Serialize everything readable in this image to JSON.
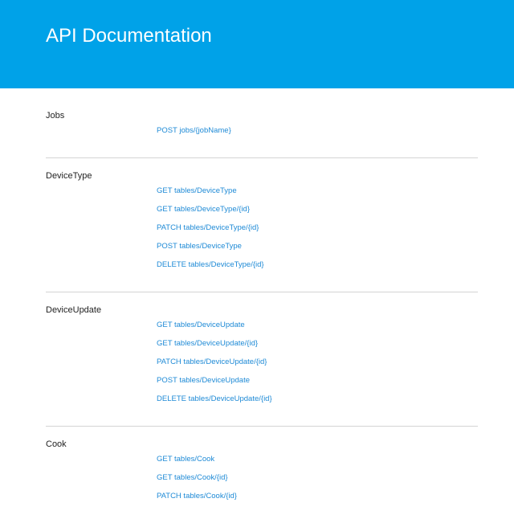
{
  "header": {
    "title": "API Documentation"
  },
  "groups": [
    {
      "name": "Jobs",
      "endpoints": [
        "POST jobs/{jobName}"
      ]
    },
    {
      "name": "DeviceType",
      "endpoints": [
        "GET tables/DeviceType",
        "GET tables/DeviceType/{id}",
        "PATCH tables/DeviceType/{id}",
        "POST tables/DeviceType",
        "DELETE tables/DeviceType/{id}"
      ]
    },
    {
      "name": "DeviceUpdate",
      "endpoints": [
        "GET tables/DeviceUpdate",
        "GET tables/DeviceUpdate/{id}",
        "PATCH tables/DeviceUpdate/{id}",
        "POST tables/DeviceUpdate",
        "DELETE tables/DeviceUpdate/{id}"
      ]
    },
    {
      "name": "Cook",
      "endpoints": [
        "GET tables/Cook",
        "GET tables/Cook/{id}",
        "PATCH tables/Cook/{id}"
      ]
    }
  ],
  "colors": {
    "header_bg": "#00a2e8",
    "link": "#1e8ad6",
    "divider": "#d4d4d4"
  }
}
